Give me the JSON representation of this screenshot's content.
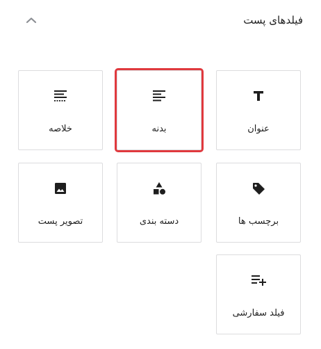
{
  "panel": {
    "title": "فیلدهای پست"
  },
  "fields": [
    {
      "label": "عنوان",
      "icon": "title-icon"
    },
    {
      "label": "بدنه",
      "icon": "align-left-icon",
      "selected": true
    },
    {
      "label": "خلاصه",
      "icon": "excerpt-icon"
    },
    {
      "label": "برچسب ها",
      "icon": "tag-icon"
    },
    {
      "label": "دسته بندی",
      "icon": "category-shapes-icon"
    },
    {
      "label": "تصویر پست",
      "icon": "image-icon"
    },
    {
      "label": "فیلد سفارشی",
      "icon": "list-add-icon"
    }
  ],
  "colors": {
    "selection_outline": "#e0393e",
    "border": "#dcdcde",
    "icon": "#1e1e1e"
  }
}
